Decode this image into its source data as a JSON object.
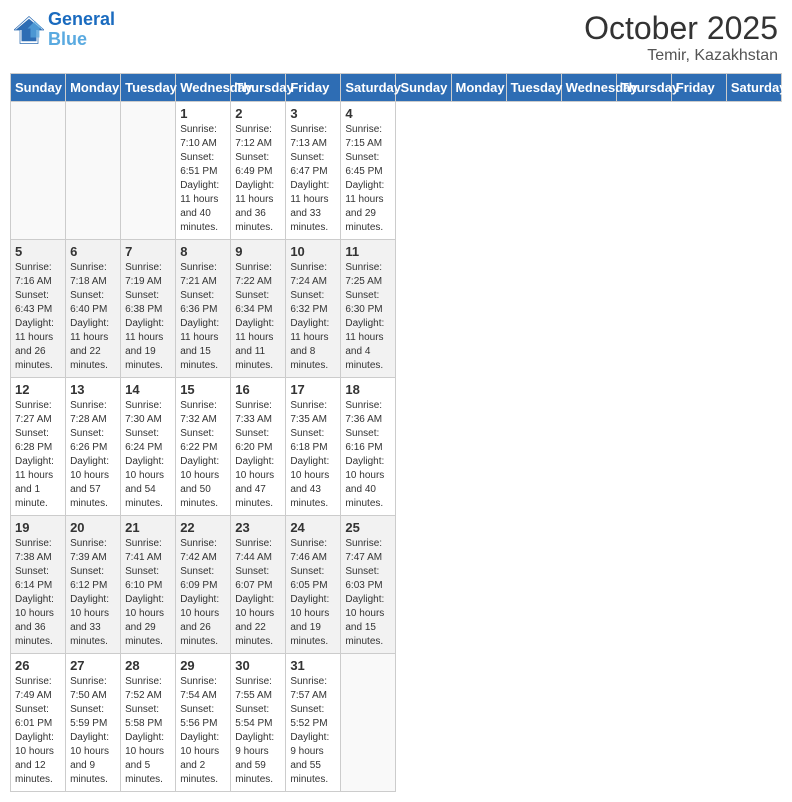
{
  "header": {
    "logo_line1": "General",
    "logo_line2": "Blue",
    "month": "October 2025",
    "location": "Temir, Kazakhstan"
  },
  "days_of_week": [
    "Sunday",
    "Monday",
    "Tuesday",
    "Wednesday",
    "Thursday",
    "Friday",
    "Saturday"
  ],
  "weeks": [
    [
      {
        "day": "",
        "sunrise": "",
        "sunset": "",
        "daylight": ""
      },
      {
        "day": "",
        "sunrise": "",
        "sunset": "",
        "daylight": ""
      },
      {
        "day": "",
        "sunrise": "",
        "sunset": "",
        "daylight": ""
      },
      {
        "day": "1",
        "sunrise": "Sunrise: 7:10 AM",
        "sunset": "Sunset: 6:51 PM",
        "daylight": "Daylight: 11 hours and 40 minutes."
      },
      {
        "day": "2",
        "sunrise": "Sunrise: 7:12 AM",
        "sunset": "Sunset: 6:49 PM",
        "daylight": "Daylight: 11 hours and 36 minutes."
      },
      {
        "day": "3",
        "sunrise": "Sunrise: 7:13 AM",
        "sunset": "Sunset: 6:47 PM",
        "daylight": "Daylight: 11 hours and 33 minutes."
      },
      {
        "day": "4",
        "sunrise": "Sunrise: 7:15 AM",
        "sunset": "Sunset: 6:45 PM",
        "daylight": "Daylight: 11 hours and 29 minutes."
      }
    ],
    [
      {
        "day": "5",
        "sunrise": "Sunrise: 7:16 AM",
        "sunset": "Sunset: 6:43 PM",
        "daylight": "Daylight: 11 hours and 26 minutes."
      },
      {
        "day": "6",
        "sunrise": "Sunrise: 7:18 AM",
        "sunset": "Sunset: 6:40 PM",
        "daylight": "Daylight: 11 hours and 22 minutes."
      },
      {
        "day": "7",
        "sunrise": "Sunrise: 7:19 AM",
        "sunset": "Sunset: 6:38 PM",
        "daylight": "Daylight: 11 hours and 19 minutes."
      },
      {
        "day": "8",
        "sunrise": "Sunrise: 7:21 AM",
        "sunset": "Sunset: 6:36 PM",
        "daylight": "Daylight: 11 hours and 15 minutes."
      },
      {
        "day": "9",
        "sunrise": "Sunrise: 7:22 AM",
        "sunset": "Sunset: 6:34 PM",
        "daylight": "Daylight: 11 hours and 11 minutes."
      },
      {
        "day": "10",
        "sunrise": "Sunrise: 7:24 AM",
        "sunset": "Sunset: 6:32 PM",
        "daylight": "Daylight: 11 hours and 8 minutes."
      },
      {
        "day": "11",
        "sunrise": "Sunrise: 7:25 AM",
        "sunset": "Sunset: 6:30 PM",
        "daylight": "Daylight: 11 hours and 4 minutes."
      }
    ],
    [
      {
        "day": "12",
        "sunrise": "Sunrise: 7:27 AM",
        "sunset": "Sunset: 6:28 PM",
        "daylight": "Daylight: 11 hours and 1 minute."
      },
      {
        "day": "13",
        "sunrise": "Sunrise: 7:28 AM",
        "sunset": "Sunset: 6:26 PM",
        "daylight": "Daylight: 10 hours and 57 minutes."
      },
      {
        "day": "14",
        "sunrise": "Sunrise: 7:30 AM",
        "sunset": "Sunset: 6:24 PM",
        "daylight": "Daylight: 10 hours and 54 minutes."
      },
      {
        "day": "15",
        "sunrise": "Sunrise: 7:32 AM",
        "sunset": "Sunset: 6:22 PM",
        "daylight": "Daylight: 10 hours and 50 minutes."
      },
      {
        "day": "16",
        "sunrise": "Sunrise: 7:33 AM",
        "sunset": "Sunset: 6:20 PM",
        "daylight": "Daylight: 10 hours and 47 minutes."
      },
      {
        "day": "17",
        "sunrise": "Sunrise: 7:35 AM",
        "sunset": "Sunset: 6:18 PM",
        "daylight": "Daylight: 10 hours and 43 minutes."
      },
      {
        "day": "18",
        "sunrise": "Sunrise: 7:36 AM",
        "sunset": "Sunset: 6:16 PM",
        "daylight": "Daylight: 10 hours and 40 minutes."
      }
    ],
    [
      {
        "day": "19",
        "sunrise": "Sunrise: 7:38 AM",
        "sunset": "Sunset: 6:14 PM",
        "daylight": "Daylight: 10 hours and 36 minutes."
      },
      {
        "day": "20",
        "sunrise": "Sunrise: 7:39 AM",
        "sunset": "Sunset: 6:12 PM",
        "daylight": "Daylight: 10 hours and 33 minutes."
      },
      {
        "day": "21",
        "sunrise": "Sunrise: 7:41 AM",
        "sunset": "Sunset: 6:10 PM",
        "daylight": "Daylight: 10 hours and 29 minutes."
      },
      {
        "day": "22",
        "sunrise": "Sunrise: 7:42 AM",
        "sunset": "Sunset: 6:09 PM",
        "daylight": "Daylight: 10 hours and 26 minutes."
      },
      {
        "day": "23",
        "sunrise": "Sunrise: 7:44 AM",
        "sunset": "Sunset: 6:07 PM",
        "daylight": "Daylight: 10 hours and 22 minutes."
      },
      {
        "day": "24",
        "sunrise": "Sunrise: 7:46 AM",
        "sunset": "Sunset: 6:05 PM",
        "daylight": "Daylight: 10 hours and 19 minutes."
      },
      {
        "day": "25",
        "sunrise": "Sunrise: 7:47 AM",
        "sunset": "Sunset: 6:03 PM",
        "daylight": "Daylight: 10 hours and 15 minutes."
      }
    ],
    [
      {
        "day": "26",
        "sunrise": "Sunrise: 7:49 AM",
        "sunset": "Sunset: 6:01 PM",
        "daylight": "Daylight: 10 hours and 12 minutes."
      },
      {
        "day": "27",
        "sunrise": "Sunrise: 7:50 AM",
        "sunset": "Sunset: 5:59 PM",
        "daylight": "Daylight: 10 hours and 9 minutes."
      },
      {
        "day": "28",
        "sunrise": "Sunrise: 7:52 AM",
        "sunset": "Sunset: 5:58 PM",
        "daylight": "Daylight: 10 hours and 5 minutes."
      },
      {
        "day": "29",
        "sunrise": "Sunrise: 7:54 AM",
        "sunset": "Sunset: 5:56 PM",
        "daylight": "Daylight: 10 hours and 2 minutes."
      },
      {
        "day": "30",
        "sunrise": "Sunrise: 7:55 AM",
        "sunset": "Sunset: 5:54 PM",
        "daylight": "Daylight: 9 hours and 59 minutes."
      },
      {
        "day": "31",
        "sunrise": "Sunrise: 7:57 AM",
        "sunset": "Sunset: 5:52 PM",
        "daylight": "Daylight: 9 hours and 55 minutes."
      },
      {
        "day": "",
        "sunrise": "",
        "sunset": "",
        "daylight": ""
      }
    ]
  ]
}
